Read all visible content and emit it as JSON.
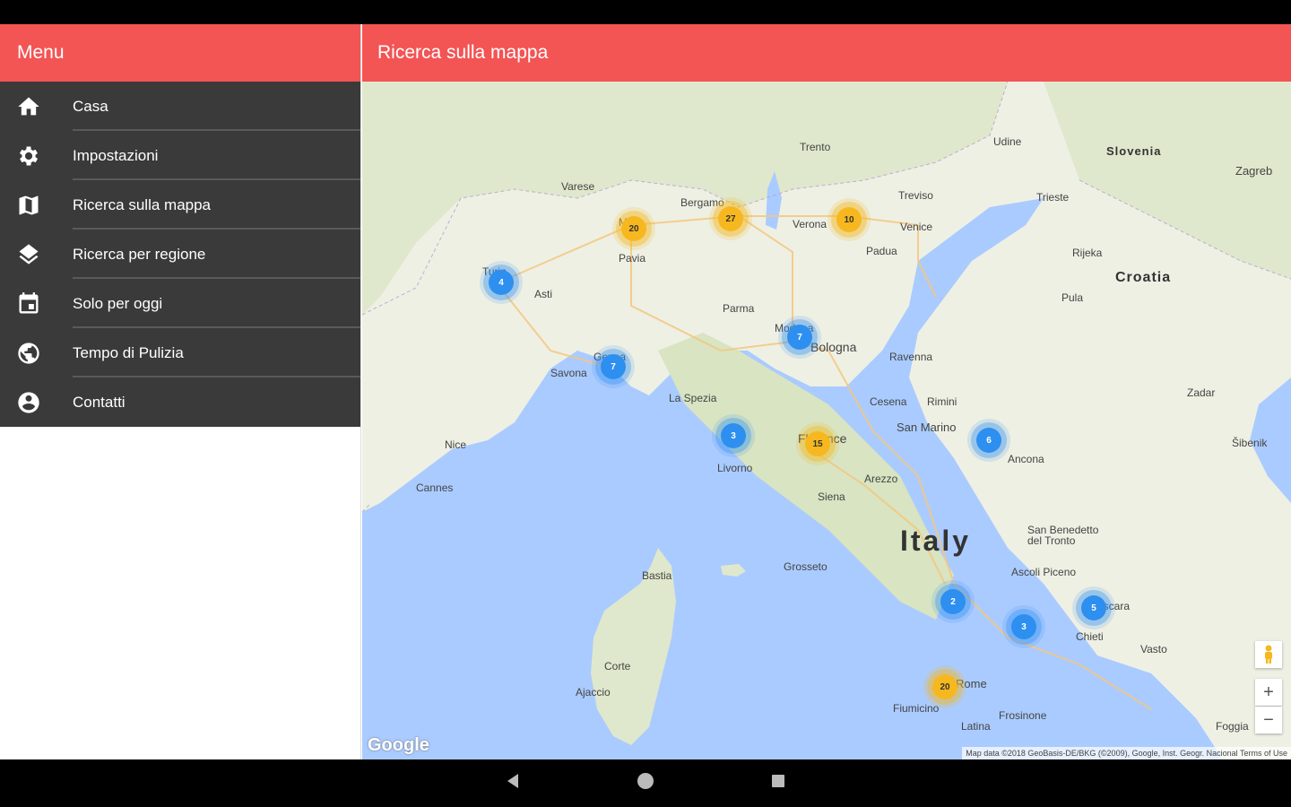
{
  "left_header": {
    "title": "Menu"
  },
  "menu": {
    "items": [
      {
        "label": "Casa",
        "icon": "home-icon"
      },
      {
        "label": "Impostazioni",
        "icon": "gear-icon"
      },
      {
        "label": "Ricerca sulla mappa",
        "icon": "map-icon"
      },
      {
        "label": "Ricerca per regione",
        "icon": "layers-icon"
      },
      {
        "label": "Solo per oggi",
        "icon": "calendar-icon"
      },
      {
        "label": "Tempo di Pulizia",
        "icon": "globe-icon"
      },
      {
        "label": "Contatti",
        "icon": "account-icon"
      }
    ]
  },
  "right_header": {
    "title": "Ricerca sulla mappa"
  },
  "map": {
    "labels": {
      "italy": "Italy",
      "croatia": "Croatia",
      "slovenia": "Slovenia",
      "zagreb": "Zagreb",
      "milan": "Milan",
      "bergamo": "Bergamo",
      "verona": "Verona",
      "venice": "Venice",
      "trento": "Trento",
      "treviso": "Treviso",
      "padua": "Padua",
      "varese": "Varese",
      "turin": "Turin",
      "asti": "Asti",
      "pavia": "Pavia",
      "parma": "Parma",
      "modena": "Modena",
      "bologna": "Bologna",
      "ravenna": "Ravenna",
      "genoa": "Genoa",
      "savona": "Savona",
      "la_spezia": "La Spezia",
      "nice": "Nice",
      "cannes": "Cannes",
      "livorno": "Livorno",
      "florence": "Florence",
      "siena": "Siena",
      "arezzo": "Arezzo",
      "rimini": "Rimini",
      "cesena": "Cesena",
      "san_marino": "San Marino",
      "ancona": "Ancona",
      "grosseto": "Grosseto",
      "bastia": "Bastia",
      "ajaccio": "Ajaccio",
      "corte": "Corte",
      "rome": "Rome",
      "latina": "Latina",
      "fiumicino": "Fiumicino",
      "frosinone": "Frosinone",
      "chieti": "Chieti",
      "pescara": "Pescara",
      "foggia": "Foggia",
      "vasto": "Vasto",
      "ascoli": "Ascoli Piceno",
      "san_benedetto": "San Benedetto del Tronto",
      "udine": "Udine",
      "trieste": "Trieste",
      "rijeka": "Rijeka",
      "pula": "Pula",
      "zadar": "Zadar",
      "sibenik": "Šibenik"
    },
    "clusters": [
      {
        "count": "4",
        "color": "blue"
      },
      {
        "count": "20",
        "color": "yellow"
      },
      {
        "count": "27",
        "color": "yellow"
      },
      {
        "count": "10",
        "color": "yellow"
      },
      {
        "count": "7",
        "color": "blue"
      },
      {
        "count": "7",
        "color": "blue"
      },
      {
        "count": "3",
        "color": "blue"
      },
      {
        "count": "15",
        "color": "yellow"
      },
      {
        "count": "6",
        "color": "blue"
      },
      {
        "count": "2",
        "color": "blue"
      },
      {
        "count": "3",
        "color": "blue"
      },
      {
        "count": "5",
        "color": "blue"
      },
      {
        "count": "20",
        "color": "yellow"
      }
    ],
    "controls": {
      "zoom_in": "+",
      "zoom_out": "−"
    },
    "google_logo": "Google",
    "attribution": "Map data ©2018 GeoBasis-DE/BKG (©2009), Google, Inst. Geogr. Nacional  Terms of Use"
  },
  "colors": {
    "header": "#f35454",
    "menu_bg": "#3a3a3a",
    "sea": "#aacbff",
    "land": "#eef0e4"
  }
}
